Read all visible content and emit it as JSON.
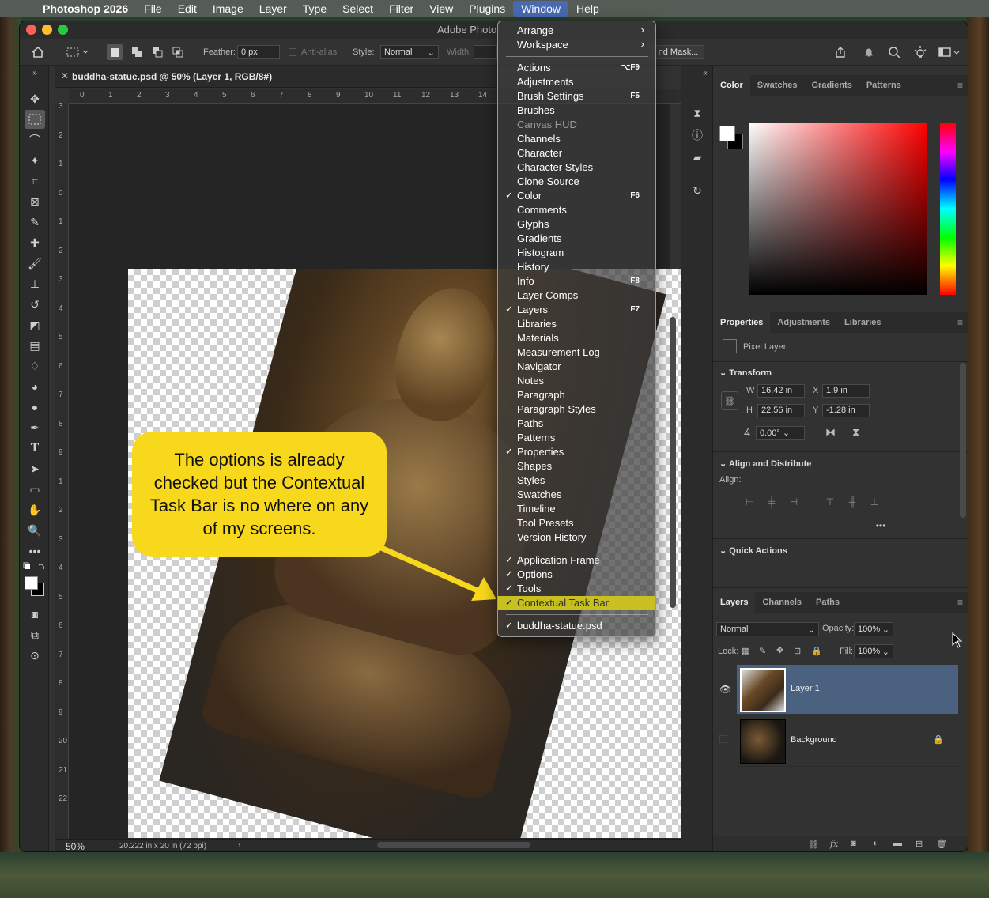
{
  "menubar": {
    "app": "Photoshop 2026",
    "items": [
      "File",
      "Edit",
      "Image",
      "Layer",
      "Type",
      "Select",
      "Filter",
      "View",
      "Plugins",
      "Window",
      "Help"
    ],
    "active": "Window"
  },
  "window": {
    "title": "Adobe Photo"
  },
  "options_bar": {
    "feather_label": "Feather:",
    "feather_value": "0 px",
    "antialias_label": "Anti-alias",
    "style_label": "Style:",
    "style_value": "Normal",
    "width_label": "Width:",
    "mask_button": "nd Mask..."
  },
  "document": {
    "tab_title": "buddha-statue.psd @ 50% (Layer 1, RGB/8#)",
    "zoom": "50%",
    "doc_info": "20.222 in x 20 in (72 ppi)",
    "ruler_h": [
      "0",
      "1",
      "2",
      "3",
      "4",
      "5",
      "6",
      "7",
      "8",
      "9",
      "10",
      "11",
      "12",
      "13",
      "14"
    ],
    "ruler_v": [
      "3",
      "2",
      "1",
      "0",
      "1",
      "2",
      "3",
      "4",
      "5",
      "6",
      "7",
      "8",
      "9",
      "1",
      "2",
      "3",
      "4",
      "5",
      "6",
      "7",
      "8",
      "9",
      "20",
      "21",
      "22"
    ]
  },
  "callout": {
    "text": "The options is already checked but the Contextual Task Bar is no where on any of my screens."
  },
  "window_menu": {
    "items": [
      {
        "label": "Arrange",
        "submenu": true
      },
      {
        "label": "Workspace",
        "submenu": true
      },
      {
        "label": "Actions",
        "shortcut": "⌥F9"
      },
      {
        "label": "Adjustments"
      },
      {
        "label": "Brush Settings",
        "shortcut": "F5"
      },
      {
        "label": "Brushes"
      },
      {
        "label": "Canvas HUD",
        "disabled": true
      },
      {
        "label": "Channels"
      },
      {
        "label": "Character"
      },
      {
        "label": "Character Styles"
      },
      {
        "label": "Clone Source"
      },
      {
        "label": "Color",
        "checked": true,
        "shortcut": "F6"
      },
      {
        "label": "Comments"
      },
      {
        "label": "Glyphs"
      },
      {
        "label": "Gradients"
      },
      {
        "label": "Histogram"
      },
      {
        "label": "History"
      },
      {
        "label": "Info",
        "shortcut": "F8"
      },
      {
        "label": "Layer Comps"
      },
      {
        "label": "Layers",
        "checked": true,
        "shortcut": "F7"
      },
      {
        "label": "Libraries"
      },
      {
        "label": "Materials"
      },
      {
        "label": "Measurement Log"
      },
      {
        "label": "Navigator"
      },
      {
        "label": "Notes"
      },
      {
        "label": "Paragraph"
      },
      {
        "label": "Paragraph Styles"
      },
      {
        "label": "Paths"
      },
      {
        "label": "Patterns"
      },
      {
        "label": "Properties",
        "checked": true
      },
      {
        "label": "Shapes"
      },
      {
        "label": "Styles"
      },
      {
        "label": "Swatches"
      },
      {
        "label": "Timeline"
      },
      {
        "label": "Tool Presets"
      },
      {
        "label": "Version History"
      },
      {
        "label": "Application Frame",
        "checked": true
      },
      {
        "label": "Options",
        "checked": true
      },
      {
        "label": "Tools",
        "checked": true
      },
      {
        "label": "Contextual Task Bar",
        "checked": true,
        "highlighted": true
      },
      {
        "label": "buddha-statue.psd",
        "checked": true
      }
    ]
  },
  "color_panel": {
    "tabs": [
      "Color",
      "Swatches",
      "Gradients",
      "Patterns"
    ],
    "active": "Color"
  },
  "properties_panel": {
    "tabs": [
      "Properties",
      "Adjustments",
      "Libraries"
    ],
    "active": "Properties",
    "layer_type": "Pixel Layer",
    "transform_title": "Transform",
    "w_label": "W",
    "w_value": "16.42 in",
    "x_label": "X",
    "x_value": "1.9 in",
    "h_label": "H",
    "h_value": "22.56 in",
    "y_label": "Y",
    "y_value": "-1.28 in",
    "angle_value": "0.00°",
    "align_title": "Align and Distribute",
    "align_label": "Align:",
    "quick_actions_title": "Quick Actions"
  },
  "layers_panel": {
    "tabs": [
      "Layers",
      "Channels",
      "Paths"
    ],
    "active": "Layers",
    "blend_mode": "Normal",
    "opacity_label": "Opacity:",
    "opacity_value": "100%",
    "lock_label": "Lock:",
    "fill_label": "Fill:",
    "fill_value": "100%",
    "layers": [
      {
        "name": "Layer 1",
        "selected": true,
        "visible": true
      },
      {
        "name": "Background",
        "selected": false,
        "locked": true
      }
    ]
  },
  "colors": {
    "callout": "#f8d81c",
    "menu_highlight": "#c8c020",
    "selected_layer": "#4a6180"
  }
}
